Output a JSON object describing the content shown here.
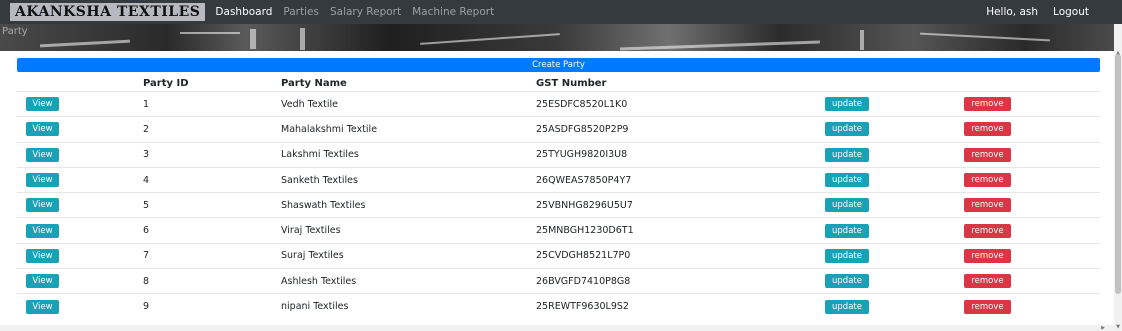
{
  "nav": {
    "brand": "AKANKSHA TEXTILES",
    "links": [
      "Dashboard",
      "Parties",
      "Salary Report",
      "Machine Report"
    ],
    "greeting": "Hello, ash",
    "logout": "Logout"
  },
  "banner": {
    "label": "Party"
  },
  "create_label": "Create Party",
  "table": {
    "headers": [
      "",
      "Party ID",
      "Party Name",
      "GST Number",
      "",
      ""
    ],
    "view_label": "View",
    "update_label": "update",
    "remove_label": "remove",
    "rows": [
      {
        "id": "1",
        "name": "Vedh Textile",
        "gst": "25ESDFC8520L1K0"
      },
      {
        "id": "2",
        "name": "Mahalakshmi Textile",
        "gst": "25ASDFG8520P2P9"
      },
      {
        "id": "3",
        "name": "Lakshmi Textiles",
        "gst": "25TYUGH9820I3U8"
      },
      {
        "id": "4",
        "name": "Sanketh Textiles",
        "gst": "26QWEAS7850P4Y7"
      },
      {
        "id": "5",
        "name": "Shaswath Textiles",
        "gst": "25VBNHG8296U5U7"
      },
      {
        "id": "6",
        "name": "Viraj Textiles",
        "gst": "25MNBGH1230D6T1"
      },
      {
        "id": "7",
        "name": "Suraj Textiles",
        "gst": "25CVDGH8521L7P0"
      },
      {
        "id": "8",
        "name": "Ashlesh Textiles",
        "gst": "26BVGFD7410P8G8"
      },
      {
        "id": "9",
        "name": "nipani Textiles",
        "gst": "25REWTF9630L9S2"
      }
    ]
  },
  "colors": {
    "navbar": "#343a40",
    "primary": "#007bff",
    "info": "#17a2b8",
    "danger": "#dc3545"
  }
}
